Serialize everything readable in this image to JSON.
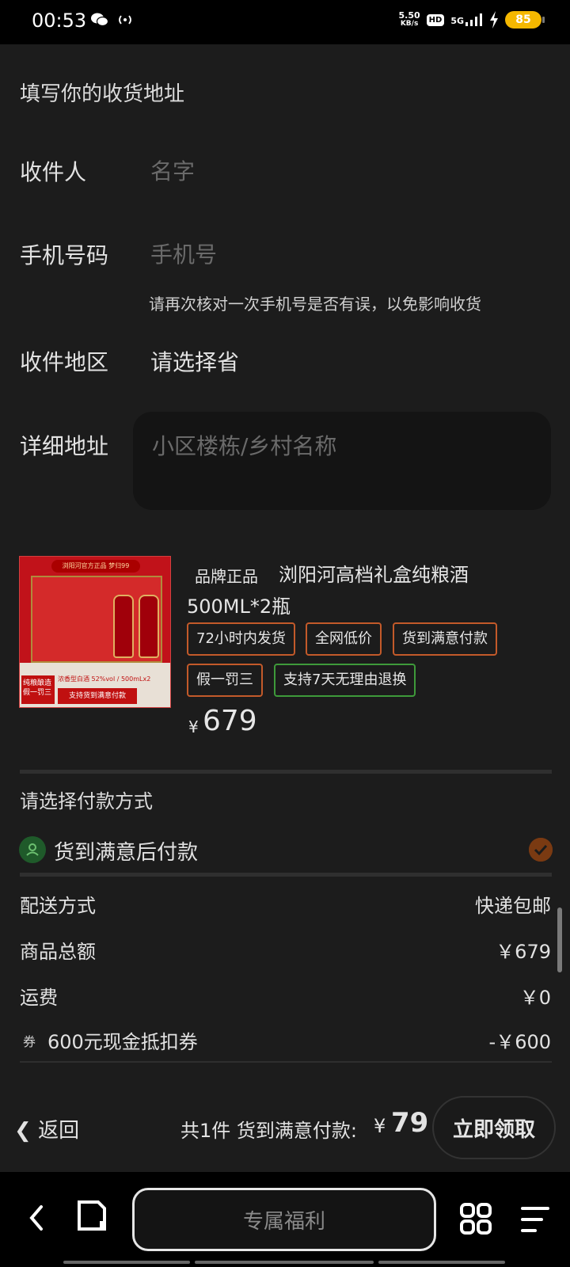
{
  "status_bar": {
    "time": "00:53",
    "net_speed_value": "5.50",
    "net_speed_unit": "KB/s",
    "hd_label": "HD",
    "signal_label": "5G",
    "battery": "85",
    "icons": [
      "wechat-icon",
      "hotspot-icon",
      "hd-icon",
      "signal-5g-icon",
      "charging-icon",
      "battery-icon"
    ]
  },
  "address_form": {
    "title": "填写你的收货地址",
    "recipient_label": "收件人",
    "recipient_placeholder": "名字",
    "phone_label": "手机号码",
    "phone_placeholder": "手机号",
    "phone_hint": "请再次核对一次手机号是否有误，以免影响收货",
    "region_label": "收件地区",
    "region_value": "请选择省",
    "detail_label": "详细地址",
    "detail_placeholder": "小区楼栋/乡村名称"
  },
  "product": {
    "image_texts": {
      "ribbon": "浏阳河官方正品 梦归99",
      "tag_left": "纯粮酿造 假一罚三",
      "spec": "浓香型白酒 52%vol / 500mLx2",
      "banner": "支持货到满意付款"
    },
    "brand_tag": "品牌正品",
    "name_line1": "浏阳河高档礼盒纯粮酒",
    "name_line2": "500ML*2瓶",
    "tags": [
      "72小时内发货",
      "全网低价",
      "货到满意付款",
      "假一罚三",
      "支持7天无理由退换"
    ],
    "price_symbol": "¥",
    "price": "679"
  },
  "payment": {
    "title": "请选择付款方式",
    "option_label": "货到满意后付款",
    "option_selected": true
  },
  "summary": {
    "shipping_label": "配送方式",
    "shipping_value": "快递包邮",
    "subtotal_label": "商品总额",
    "subtotal_value": "￥679",
    "freight_label": "运费",
    "freight_value": "￥0",
    "coupon_icon_text": "券",
    "coupon_label": "600元现金抵扣券",
    "coupon_value": "-￥600"
  },
  "bottom_bar": {
    "back_label": "返回",
    "total_text": "共1件 货到满意付款:",
    "total_currency": "¥",
    "total_amount": "79",
    "claim_button": "立即领取"
  },
  "nav_bar": {
    "center_pill_label": "专属福利"
  },
  "colors": {
    "background": "#1c1c1c",
    "tag_border_orange": "#c35a2a",
    "tag_border_green": "#3e9a3a",
    "battery": "#f5b800"
  }
}
